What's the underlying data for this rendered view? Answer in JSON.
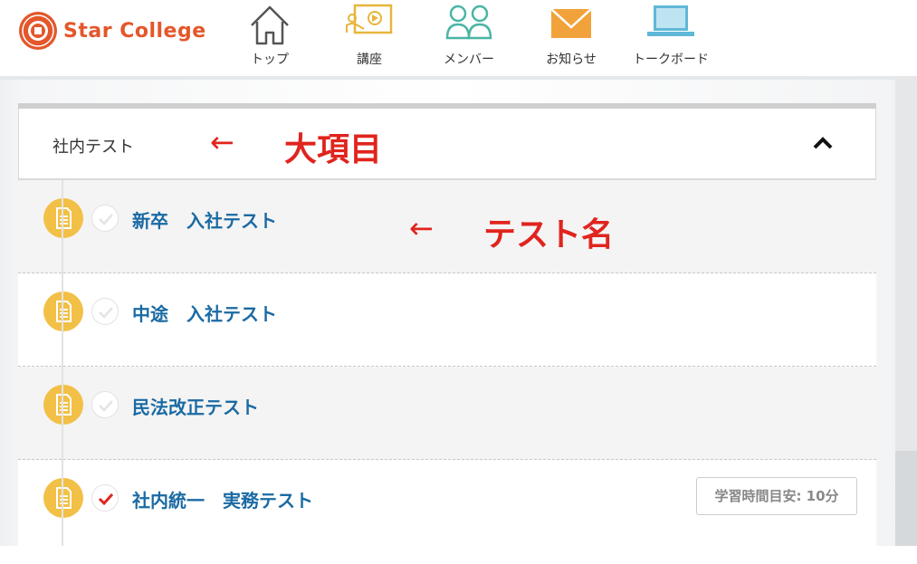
{
  "app": {
    "logo_text": "Star College",
    "brand_color": "#e3572b"
  },
  "nav": {
    "items": [
      {
        "label": "トップ",
        "icon": "home-icon"
      },
      {
        "label": "講座",
        "icon": "presentation-board-icon"
      },
      {
        "label": "メンバー",
        "icon": "members-icon"
      },
      {
        "label": "お知らせ",
        "icon": "envelope-icon"
      },
      {
        "label": "トークボード",
        "icon": "laptop-icon"
      }
    ]
  },
  "section": {
    "title": "社内テスト",
    "annotation": "大項目",
    "collapse_icon": "chevron-up-icon"
  },
  "tests": [
    {
      "title": "新卒　入社テスト",
      "completed": false,
      "annotation": "テスト名"
    },
    {
      "title": "中途　入社テスト",
      "completed": false
    },
    {
      "title": "民法改正テスト",
      "completed": false
    },
    {
      "title": "社内統一　実務テスト",
      "completed": true,
      "study_time": "学習時間目安: 10分"
    }
  ],
  "colors": {
    "link_blue": "#1a6aa3",
    "doc_icon_yellow": "#f2c046",
    "check_red": "#e0241e",
    "annotation_red": "#e0241e"
  },
  "annotation_arrow": "←"
}
